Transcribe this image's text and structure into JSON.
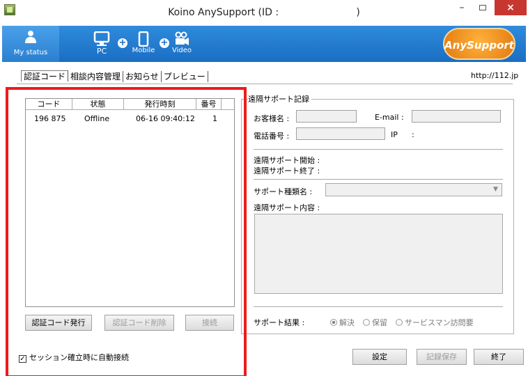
{
  "window": {
    "title": "Koino AnySupport (ID :                         )",
    "min_glyph": "–",
    "close_glyph": "×"
  },
  "toolbar": {
    "my_status": "My status",
    "pc": "PC",
    "mobile": "Mobile",
    "video": "Video",
    "logo": "AnySupport",
    "plus_glyph": "+"
  },
  "tabs": [
    "認証コード",
    "相談内容管理",
    "お知らせ",
    "プレビュー"
  ],
  "url": "http://112.jp",
  "list": {
    "headers": [
      "コード",
      "状態",
      "発行時刻",
      "番号"
    ],
    "rows": [
      {
        "code": "196 875",
        "status": "Offline",
        "time": "06-16 09:40:12",
        "number": "1"
      }
    ]
  },
  "buttons": {
    "issue_code": "認証コード発行",
    "delete_code": "認証コード削除",
    "connect": "接続",
    "settings": "設定",
    "save_record": "記録保存",
    "exit": "終了"
  },
  "record": {
    "group_title": "遠隔サポート記録",
    "customer_name": "お客様名 :",
    "email": "E-mail :",
    "phone": "電話番号 :",
    "ip": "IP",
    "ip_colon": ":",
    "start": "遠隔サポート開始 :",
    "end": "遠隔サポート終了 :",
    "support_type": "サポート種類名 :",
    "support_content": "遠隔サポート内容 :",
    "result_label": "サポート結果 :",
    "combo_arrow": "▼",
    "results": [
      "解決",
      "保留",
      "サービスマン訪問要"
    ]
  },
  "auto_connect": "セッション確立時に自動接続",
  "checkbox_glyph": "✓",
  "colors": {
    "toolbar": "#1a6ec3",
    "highlight": "#ee1b1b",
    "close": "#c7372f",
    "logo": "#f08c1a"
  }
}
